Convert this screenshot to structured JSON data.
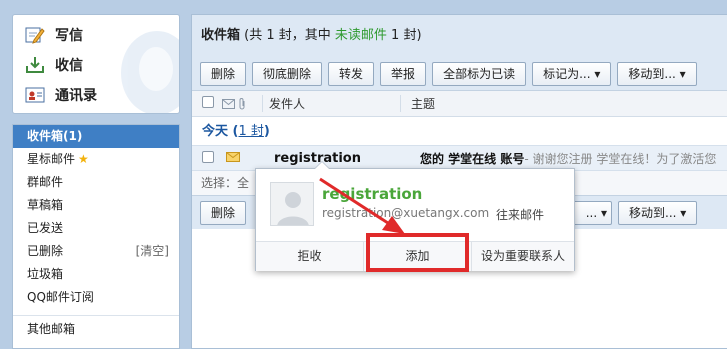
{
  "compose": {
    "write": "写信",
    "receive": "收信",
    "contacts": "通讯录"
  },
  "folders": [
    {
      "label": "收件箱(1)",
      "active": true
    },
    {
      "label": "星标邮件",
      "star": true
    },
    {
      "label": "群邮件"
    },
    {
      "label": "草稿箱"
    },
    {
      "label": "已发送"
    },
    {
      "label": "已删除",
      "extra": "[清空]"
    },
    {
      "label": "垃圾箱"
    },
    {
      "label": "QQ邮件订阅"
    }
  ],
  "folders_other": "其他邮箱",
  "inbox": {
    "title": "收件箱",
    "summary_prefix": "(共 1 封，其中 ",
    "summary_unread": "未读邮件",
    "summary_suffix": " 1 封)"
  },
  "toolbar": {
    "delete": "删除",
    "perm_delete": "彻底删除",
    "forward": "转发",
    "report": "举报",
    "mark_all_read": "全部标为已读",
    "mark_as": "标记为... ▾",
    "move_to": "移动到... ▾"
  },
  "columns": {
    "sender": "发件人",
    "subject": "主题"
  },
  "group": {
    "label": "今天",
    "count": "1 封"
  },
  "email": {
    "sender": "registration",
    "subject": "您的 学堂在线 账号",
    "preview": " - 谢谢您注册 学堂在线！为了激活您"
  },
  "select_text": "选择：全",
  "popup": {
    "name": "registration",
    "email": "registration@xuetangx.com",
    "history": "往来邮件",
    "reject": "拒收",
    "add": "添加",
    "important": "设为重要联系人"
  },
  "colors": {
    "highlight": "#e02a2a",
    "accent": "#3f7fc5",
    "unread": "#2f9a2f"
  }
}
